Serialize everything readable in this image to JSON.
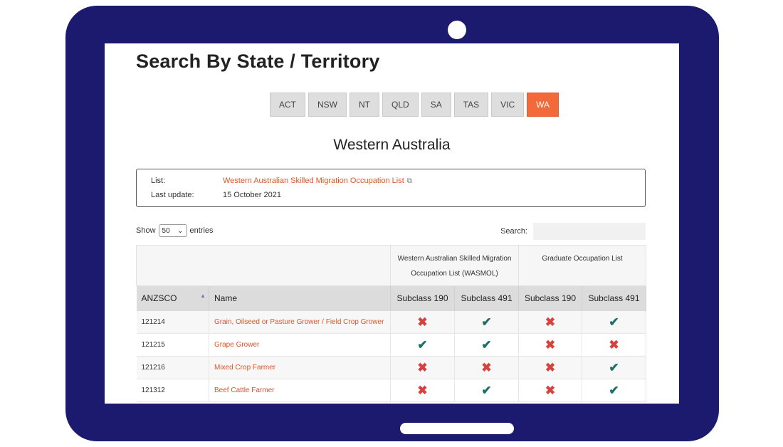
{
  "page": {
    "title": "Search By State / Territory",
    "state_tabs": [
      "ACT",
      "NSW",
      "NT",
      "QLD",
      "SA",
      "TAS",
      "VIC",
      "WA"
    ],
    "active_tab": "WA",
    "state_heading": "Western Australia"
  },
  "info": {
    "list_label": "List:",
    "list_link": "Western Australian Skilled Migration Occupation List",
    "update_label": "Last update:",
    "update_value": "15 October 2021"
  },
  "controls": {
    "show_label": "Show",
    "entries_value": "50",
    "entries_label": "entries",
    "search_label": "Search:"
  },
  "table": {
    "group_headers": [
      "Western Australian Skilled Migration Occupation List (WASMOL)",
      "Graduate Occupation List"
    ],
    "columns": [
      "ANZSCO",
      "Name",
      "Subclass 190",
      "Subclass 491",
      "Subclass 190",
      "Subclass 491"
    ],
    "rows": [
      {
        "code": "121214",
        "name": "Grain, Oilseed or Pasture Grower / Field Crop Grower",
        "marks": [
          "cross",
          "tick",
          "cross",
          "tick"
        ]
      },
      {
        "code": "121215",
        "name": "Grape Grower",
        "marks": [
          "tick",
          "tick",
          "cross",
          "cross"
        ]
      },
      {
        "code": "121216",
        "name": "Mixed Crop Farmer",
        "marks": [
          "cross",
          "cross",
          "cross",
          "tick"
        ]
      },
      {
        "code": "121312",
        "name": "Beef Cattle Farmer",
        "marks": [
          "cross",
          "tick",
          "cross",
          "tick"
        ]
      }
    ]
  },
  "icons": {
    "tick": "check-icon",
    "cross": "cross-icon",
    "external": "external-link-icon",
    "sort": "sort-asc-icon"
  },
  "colors": {
    "frame": "#1b1a6e",
    "accent": "#f26a3a",
    "link": "#e0542a",
    "tick": "#1f6f68",
    "cross": "#d8423e"
  }
}
